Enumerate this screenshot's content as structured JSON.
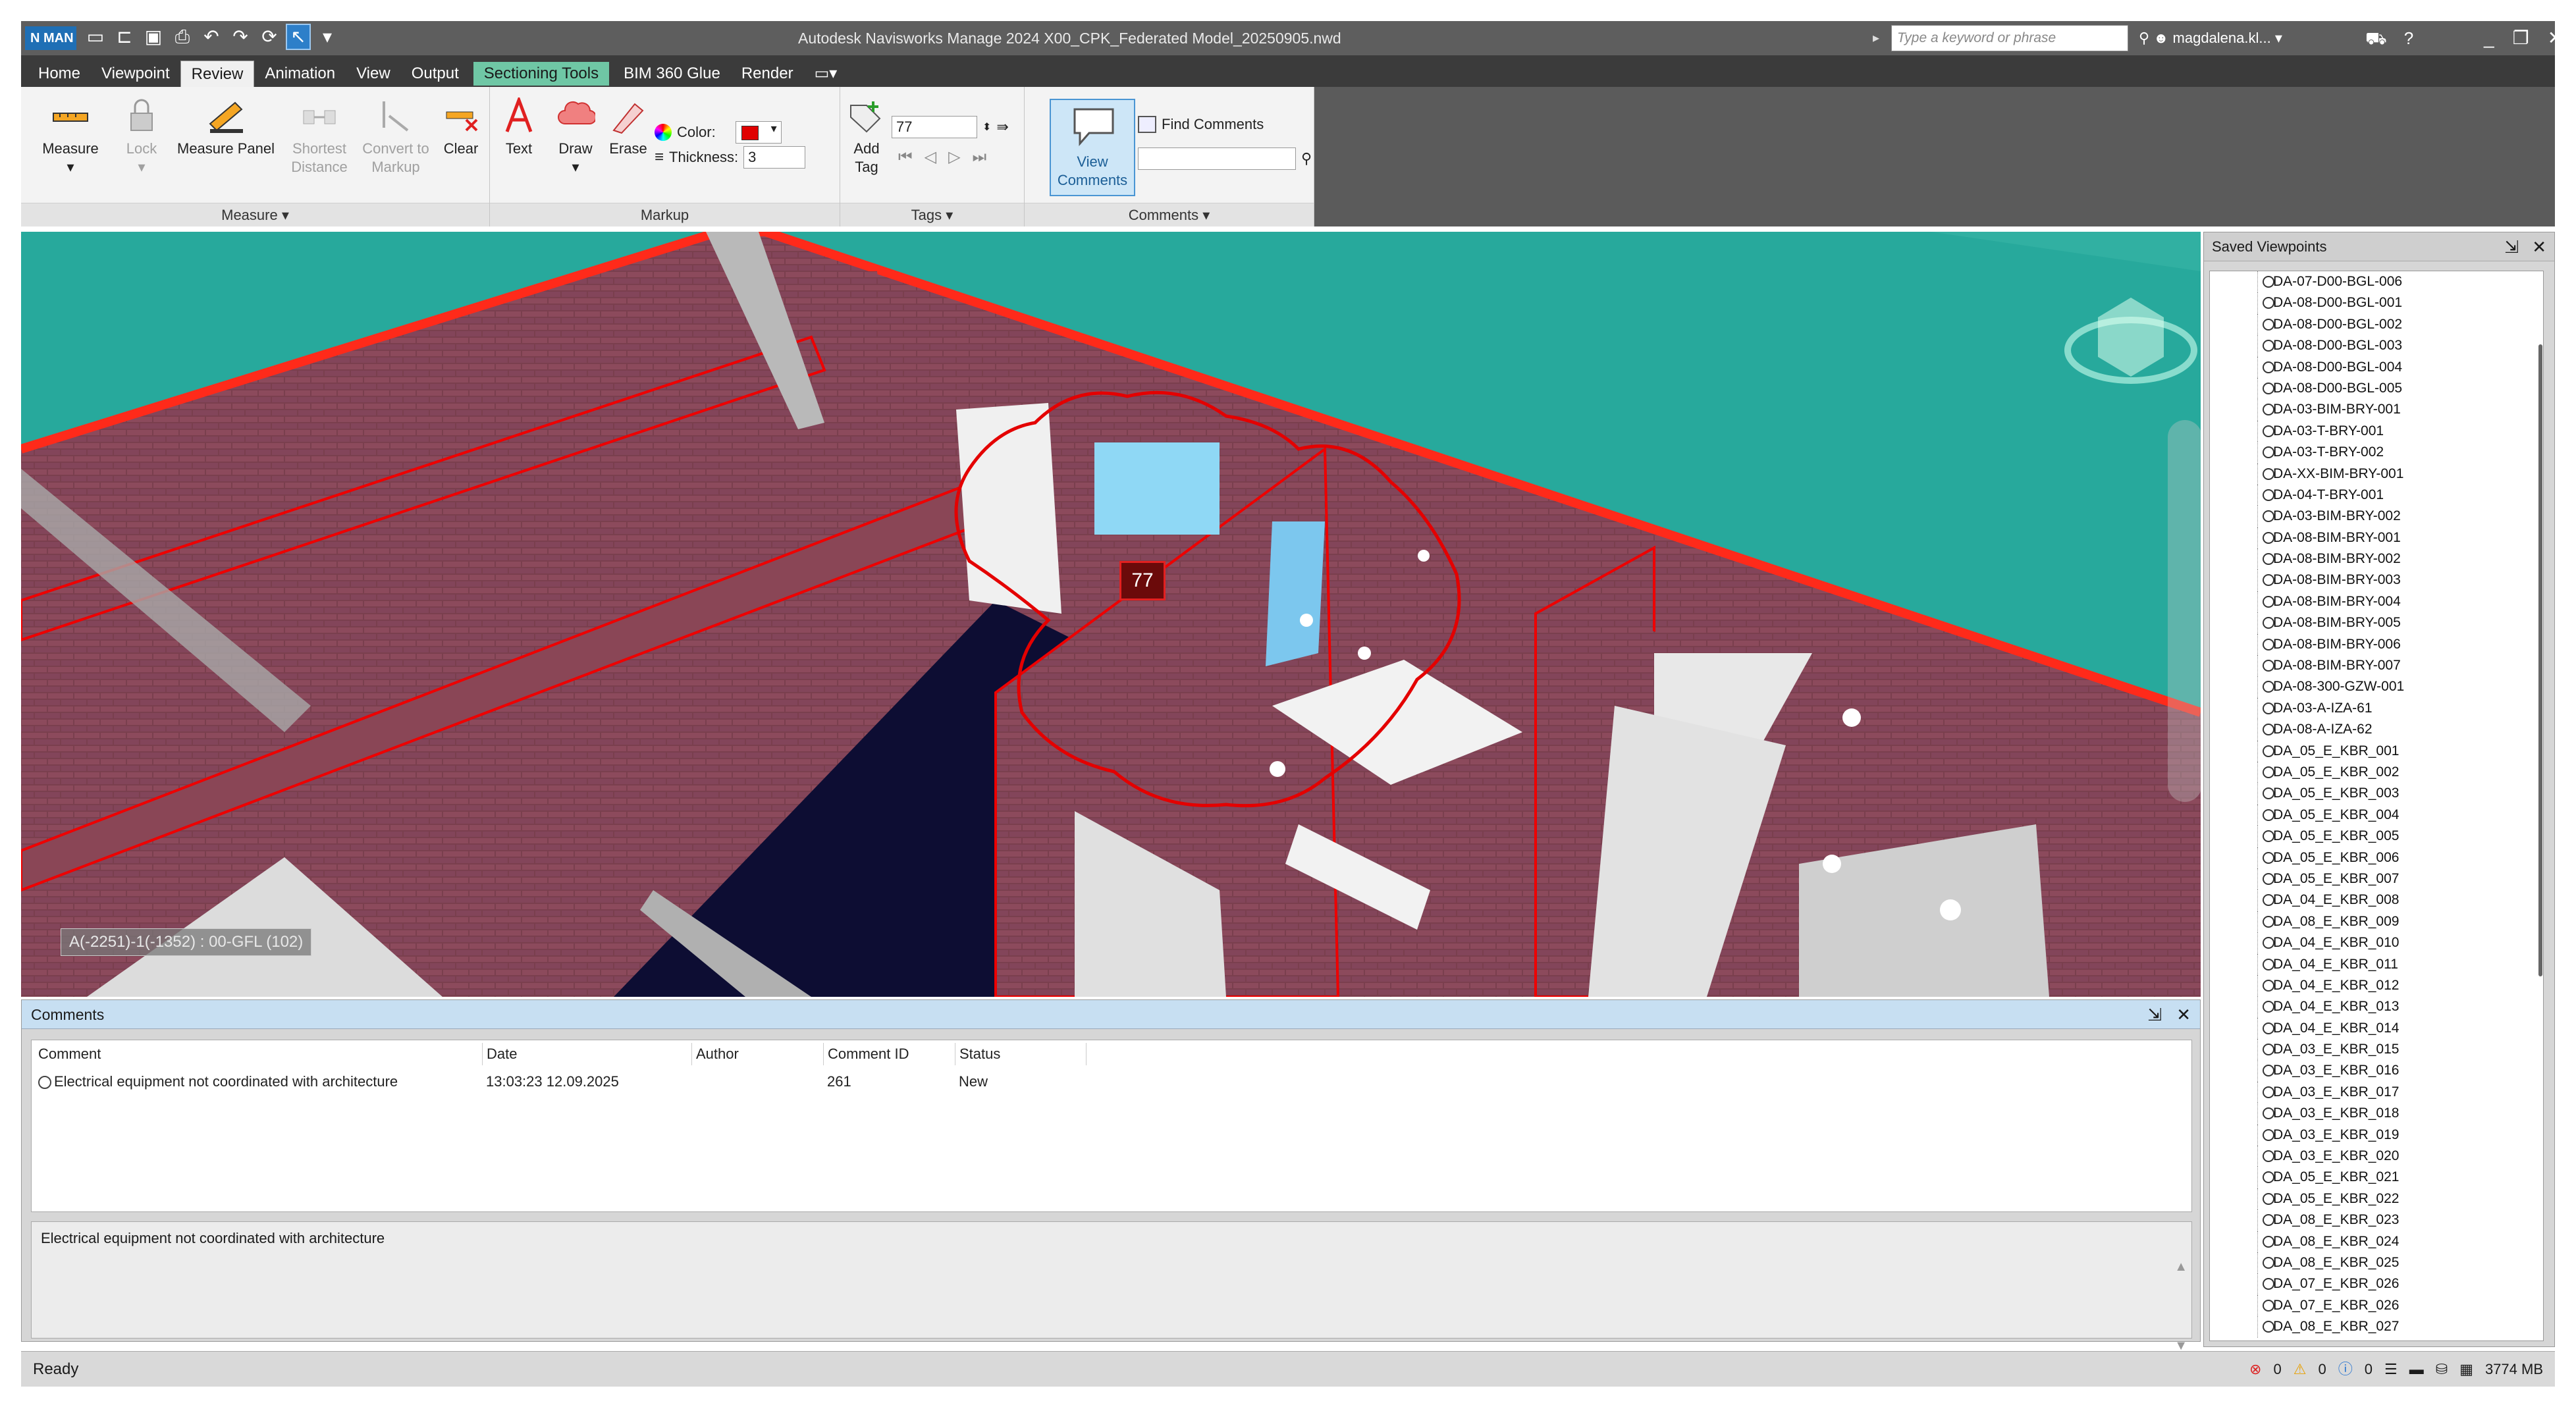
{
  "app": {
    "logo_text": "N MAN",
    "title": "Autodesk Navisworks Manage 2024   X00_CPK_Federated Model_20250905.nwd",
    "search_placeholder": "Type a keyword or phrase",
    "user": "magdalena.kl...",
    "qat_icons": [
      "new-icon",
      "open-icon",
      "save-icon",
      "print-icon",
      "undo-icon",
      "redo-icon",
      "select-icon"
    ]
  },
  "tabs": [
    "Home",
    "Viewpoint",
    "Review",
    "Animation",
    "View",
    "Output",
    "Sectioning Tools",
    "BIM 360 Glue",
    "Render"
  ],
  "active_tab": "Review",
  "ribbon": {
    "measure": {
      "buttons": [
        "Measure",
        "Lock",
        "Measure Panel",
        "Shortest Distance",
        "Convert to Markup",
        "Clear"
      ],
      "panel_label": "Measure"
    },
    "markup": {
      "buttons": [
        "Text",
        "Draw",
        "Erase"
      ],
      "color_label": "Color:",
      "color_value": "#e00000",
      "thickness_label": "Thickness:",
      "thickness_value": "3",
      "panel_label": "Markup"
    },
    "tags": {
      "add_tag": "Add Tag",
      "tag_value": "77",
      "panel_label": "Tags"
    },
    "comments": {
      "view_comments": "View Comments",
      "find_comments": "Find Comments",
      "panel_label": "Comments"
    }
  },
  "viewport": {
    "location_tag": "A(-2251)-1(-1352) : 00-GFL (102)",
    "tag_number": "77"
  },
  "comments_panel": {
    "title": "Comments",
    "columns": [
      "Comment",
      "Date",
      "Author",
      "Comment ID",
      "Status"
    ],
    "rows": [
      {
        "comment": "Electrical equipment not coordinated with architecture",
        "date": "13:03:23 12.09.2025",
        "author": "",
        "id": "261",
        "status": "New"
      }
    ],
    "detail": "Electrical equipment not coordinated with architecture"
  },
  "saved_viewpoints": {
    "title": "Saved Viewpoints",
    "items": [
      "DA-07-D00-BGL-006",
      "DA-08-D00-BGL-001",
      "DA-08-D00-BGL-002",
      "DA-08-D00-BGL-003",
      "DA-08-D00-BGL-004",
      "DA-08-D00-BGL-005",
      "DA-03-BIM-BRY-001",
      "DA-03-T-BRY-001",
      "DA-03-T-BRY-002",
      "DA-XX-BIM-BRY-001",
      "DA-04-T-BRY-001",
      "DA-03-BIM-BRY-002",
      "DA-08-BIM-BRY-001",
      "DA-08-BIM-BRY-002",
      "DA-08-BIM-BRY-003",
      "DA-08-BIM-BRY-004",
      "DA-08-BIM-BRY-005",
      "DA-08-BIM-BRY-006",
      "DA-08-BIM-BRY-007",
      "DA-08-300-GZW-001",
      "DA-03-A-IZA-61",
      "DA-08-A-IZA-62",
      "DA_05_E_KBR_001",
      "DA_05_E_KBR_002",
      "DA_05_E_KBR_003",
      "DA_05_E_KBR_004",
      "DA_05_E_KBR_005",
      "DA_05_E_KBR_006",
      "DA_05_E_KBR_007",
      "DA_04_E_KBR_008",
      "DA_08_E_KBR_009",
      "DA_04_E_KBR_010",
      "DA_04_E_KBR_011",
      "DA_04_E_KBR_012",
      "DA_04_E_KBR_013",
      "DA_04_E_KBR_014",
      "DA_03_E_KBR_015",
      "DA_03_E_KBR_016",
      "DA_03_E_KBR_017",
      "DA_03_E_KBR_018",
      "DA_03_E_KBR_019",
      "DA_03_E_KBR_020",
      "DA_05_E_KBR_021",
      "DA_05_E_KBR_022",
      "DA_08_E_KBR_023",
      "DA_08_E_KBR_024",
      "DA_08_E_KBR_025",
      "DA_07_E_KBR_026",
      "DA_07_E_KBR_026",
      "DA_08_E_KBR_027"
    ]
  },
  "status": {
    "text": "Ready",
    "counts": [
      "0",
      "0",
      "0"
    ],
    "memory": "3774 MB"
  }
}
